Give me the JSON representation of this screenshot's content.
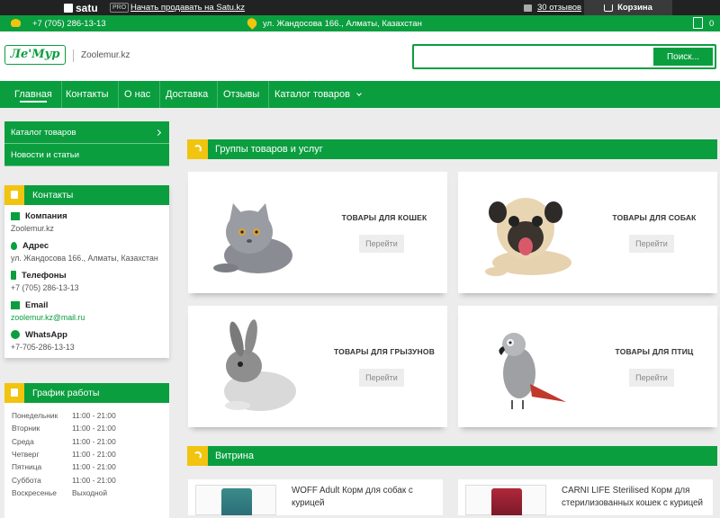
{
  "satu": {
    "logo": "satu",
    "pro": "PRO",
    "sell_link": "Начать продавать на Satu.kz",
    "reviews": "30 отзывов",
    "cart": "Корзина"
  },
  "info": {
    "phone": "+7 (705) 286-13-13",
    "address": "ул. Жандосова 166., Алматы, Казахстан",
    "cart_count": "0"
  },
  "header": {
    "logo": "Ле'Мур",
    "site_name": "Zoolemur.kz",
    "search_placeholder": "",
    "search_button": "Поиск..."
  },
  "nav": {
    "items": [
      {
        "label": "Главная"
      },
      {
        "label": "Контакты"
      },
      {
        "label": "О нас"
      },
      {
        "label": "Доставка"
      },
      {
        "label": "Отзывы"
      },
      {
        "label": "Каталог товаров"
      }
    ]
  },
  "sidebar": {
    "menu": [
      {
        "label": "Каталог товаров"
      },
      {
        "label": "Новости и статьи"
      }
    ],
    "contacts": {
      "title": "Контакты",
      "items": [
        {
          "title": "Компания",
          "value": "Zoolemur.kz",
          "icon": "home-icon"
        },
        {
          "title": "Адрес",
          "value": "ул. Жандосова 166., Алматы, Казахстан",
          "icon": "pin-icon"
        },
        {
          "title": "Телефоны",
          "value": "+7 (705) 286-13-13",
          "icon": "phone-icon"
        },
        {
          "title": "Email",
          "value": "zoolemur.kz@mail.ru",
          "icon": "mail-icon"
        },
        {
          "title": "WhatsApp",
          "value": "+7-705-286-13-13",
          "icon": "whatsapp-icon"
        }
      ]
    },
    "hours": {
      "title": "График работы",
      "rows": [
        {
          "day": "Понедельник",
          "time": "11:00 - 21:00"
        },
        {
          "day": "Вторник",
          "time": "11:00 - 21:00"
        },
        {
          "day": "Среда",
          "time": "11:00 - 21:00"
        },
        {
          "day": "Четверг",
          "time": "11:00 - 21:00"
        },
        {
          "day": "Пятница",
          "time": "11:00 - 21:00"
        },
        {
          "day": "Суббота",
          "time": "11:00 - 21:00"
        },
        {
          "day": "Воскресенье",
          "time": "Выходной"
        }
      ]
    }
  },
  "main": {
    "groups_title": "Группы товаров и услуг",
    "groups": [
      {
        "title": "ТОВАРЫ ДЛЯ КОШЕК",
        "button": "Перейти"
      },
      {
        "title": "ТОВАРЫ ДЛЯ СОБАК",
        "button": "Перейти"
      },
      {
        "title": "ТОВАРЫ ДЛЯ ГРЫЗУНОВ",
        "button": "Перейти"
      },
      {
        "title": "ТОВАРЫ ДЛЯ ПТИЦ",
        "button": "Перейти"
      }
    ],
    "showcase_title": "Витрина",
    "products": [
      {
        "name": "WOFF Adult Корм для собак с курицей"
      },
      {
        "name": "CARNI LIFE Sterilised Корм для стерилизованных кошек с курицей"
      }
    ]
  },
  "colors": {
    "brand_green": "#0a9e3f",
    "accent_yellow": "#f1c40f",
    "dark_bar": "#222222"
  }
}
